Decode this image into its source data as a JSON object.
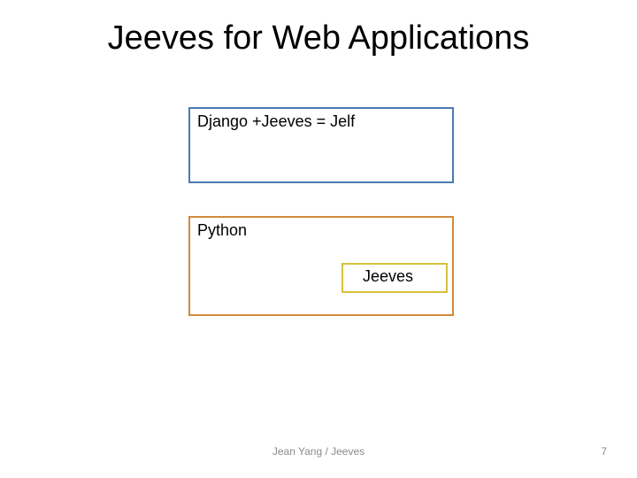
{
  "title": "Jeeves for Web Applications",
  "boxes": {
    "top": {
      "label": "Django +Jeeves = Jelf",
      "border_color": "#4a7ab5"
    },
    "bottom": {
      "label": "Python",
      "border_color": "#d08a3a"
    },
    "inner": {
      "label": "Jeeves",
      "border_color": "#d6c23e"
    }
  },
  "footer": {
    "center": "Jean Yang / Jeeves",
    "page_number": "7"
  }
}
